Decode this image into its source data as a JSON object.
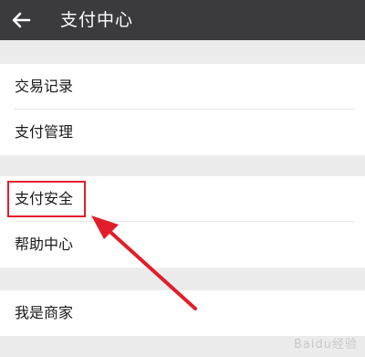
{
  "header": {
    "title": "支付中心",
    "back_icon": "arrow-left-icon"
  },
  "menu_groups": [
    {
      "items": [
        {
          "label": "交易记录"
        },
        {
          "label": "支付管理"
        }
      ]
    },
    {
      "items": [
        {
          "label": "支付安全"
        },
        {
          "label": "帮助中心"
        }
      ]
    },
    {
      "items": [
        {
          "label": "我是商家"
        }
      ]
    }
  ],
  "annotation": {
    "highlight_color": "#e21d2b",
    "target": "支付安全"
  },
  "watermark": "Baidu经验",
  "colors": {
    "header_bg": "#3a3a3f",
    "page_bg": "#ececec",
    "row_bg": "#ffffff"
  }
}
